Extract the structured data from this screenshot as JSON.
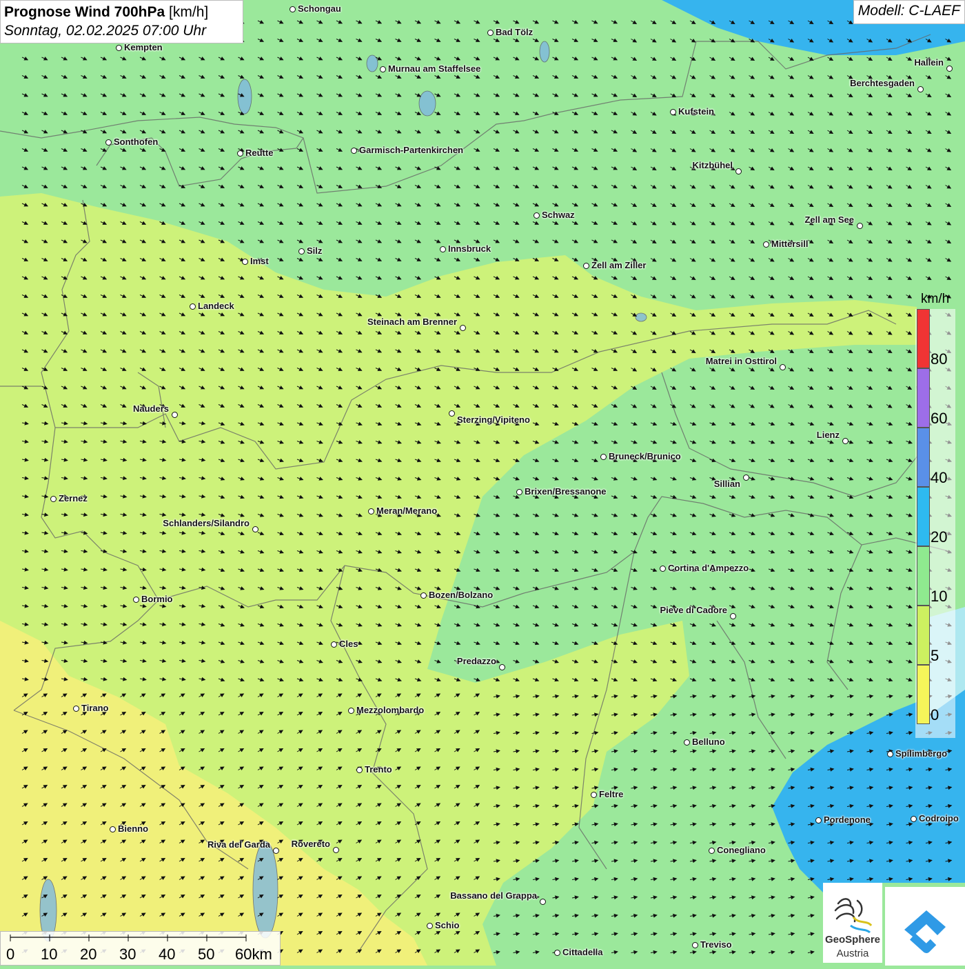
{
  "title": {
    "bold": "Prognose Wind 700hPa",
    "unit": "[km/h]",
    "date": "Sonntag, 02.02.2025 07:00 Uhr"
  },
  "model": "Modell: C-LAEF",
  "legend": {
    "unit": "km/h",
    "labels": [
      "80",
      "60",
      "40",
      "20",
      "10",
      "5",
      "0"
    ],
    "colors": [
      "#f03434",
      "#9d6ee8",
      "#5a90e8",
      "#2ebaf0",
      "#8fea8f",
      "#cdf060",
      "#f5f55a"
    ]
  },
  "scale": {
    "labels": [
      "0",
      "10",
      "20",
      "30",
      "40",
      "50",
      "60km"
    ]
  },
  "cities": [
    {
      "name": "Schongau"
    },
    {
      "name": "Bad Tölz"
    },
    {
      "name": "Kempten"
    },
    {
      "name": "Murnau am Staffelsee"
    },
    {
      "name": "Hallein"
    },
    {
      "name": "Berchtesgaden"
    },
    {
      "name": "Kufstein"
    },
    {
      "name": "Sonthofen"
    },
    {
      "name": "Reutte"
    },
    {
      "name": "Garmisch-Partenkirchen"
    },
    {
      "name": "Kitzbühel"
    },
    {
      "name": "Schwaz"
    },
    {
      "name": "Zell am See"
    },
    {
      "name": "Mittersill"
    },
    {
      "name": "Silz"
    },
    {
      "name": "Innsbruck"
    },
    {
      "name": "Imst"
    },
    {
      "name": "Zell am Ziller"
    },
    {
      "name": "Landeck"
    },
    {
      "name": "Steinach am Brenner"
    },
    {
      "name": "Matrei in Osttirol"
    },
    {
      "name": "Nauders"
    },
    {
      "name": "Sterzing/Vipiteno"
    },
    {
      "name": "Lienz"
    },
    {
      "name": "Bruneck/Brunico"
    },
    {
      "name": "Sillian"
    },
    {
      "name": "Brixen/Bressanone"
    },
    {
      "name": "Zernez"
    },
    {
      "name": "Meran/Merano"
    },
    {
      "name": "Schlanders/Silandro"
    },
    {
      "name": "Cortina d'Ampezzo"
    },
    {
      "name": "Bozen/Bolzano"
    },
    {
      "name": "Bormio"
    },
    {
      "name": "Pieve di Cadore"
    },
    {
      "name": "Cles"
    },
    {
      "name": "Predazzo"
    },
    {
      "name": "Tirano"
    },
    {
      "name": "Mezzolombardo"
    },
    {
      "name": "Belluno"
    },
    {
      "name": "Spilimbergo"
    },
    {
      "name": "Trento"
    },
    {
      "name": "Feltre"
    },
    {
      "name": "Pordenone"
    },
    {
      "name": "Codroipo"
    },
    {
      "name": "Bienno"
    },
    {
      "name": "Riva del Garda"
    },
    {
      "name": "Rovereto"
    },
    {
      "name": "Conegliano"
    },
    {
      "name": "Bassano del Grappa"
    },
    {
      "name": "Schio"
    },
    {
      "name": "Treviso"
    },
    {
      "name": "Cittadella"
    }
  ],
  "logo": {
    "line1": "GeoSphere",
    "line2": "Austria"
  }
}
